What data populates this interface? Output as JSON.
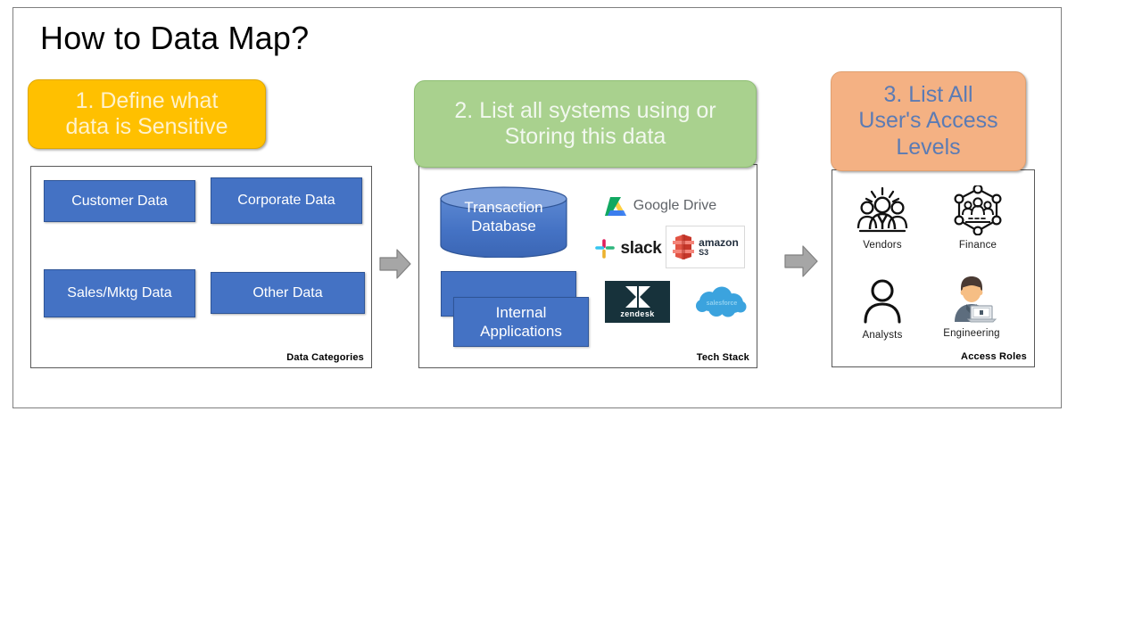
{
  "slide": {
    "title": "How to Data Map?"
  },
  "steps": [
    {
      "header": "1. Define what data is Sensitive",
      "header_lines": [
        "1. Define what",
        "data is Sensitive"
      ],
      "header_color": "#FFC000",
      "header_text_color": "#FFF2CC",
      "caption": "Data Categories",
      "items": [
        {
          "label": "Customer Data"
        },
        {
          "label": "Corporate Data",
          "lines": [
            "Corporate",
            "Data"
          ]
        },
        {
          "label": "Sales/Mktg Data",
          "lines": [
            "Sales/Mktg",
            "Data"
          ]
        },
        {
          "label": "Other Data"
        }
      ]
    },
    {
      "header": "2. List all systems using or Storing this data",
      "header_lines": [
        "2. List all systems using or",
        "Storing this data"
      ],
      "header_color": "#A9D18E",
      "header_text_color": "#F2F8EF",
      "caption": "Tech Stack",
      "shapes": [
        {
          "name": "database-cylinder",
          "label": "Transaction Database",
          "lines": [
            "Transaction",
            "Database"
          ]
        },
        {
          "name": "applications-rectangle",
          "label": "Internal Applications",
          "lines": [
            "Internal",
            "Applications"
          ]
        }
      ],
      "logos": [
        {
          "name": "google-drive-logo",
          "label": "Google Drive",
          "word1": "Google",
          "word2": "Drive"
        },
        {
          "name": "slack-logo",
          "label": "slack"
        },
        {
          "name": "amazon-s3-logo",
          "label": "amazon S3",
          "line1": "amazon",
          "line2": "S3"
        },
        {
          "name": "zendesk-logo",
          "label": "zendesk"
        },
        {
          "name": "salesforce-logo",
          "label": "salesforce"
        }
      ]
    },
    {
      "header": "3. List All User's Access Levels",
      "header_lines": [
        "3. List All",
        "User's Access",
        "Levels"
      ],
      "header_color": "#F4B183",
      "header_text_color": "#5B7BB4",
      "caption": "Access Roles",
      "roles": [
        {
          "label": "Vendors",
          "icon": "group-of-people-icon"
        },
        {
          "label": "Finance",
          "icon": "network-team-icon"
        },
        {
          "label": "Analysts",
          "icon": "single-person-icon"
        },
        {
          "label": "Engineering",
          "icon": "person-with-laptop-icon"
        }
      ]
    }
  ],
  "arrows": [
    {
      "name": "arrow-step1-to-step2",
      "direction": "right"
    },
    {
      "name": "arrow-step2-to-step3",
      "direction": "right"
    }
  ],
  "colors": {
    "frame_border": "#7f7f7f",
    "panel_border": "#595959",
    "box_blue": "#4472C4",
    "box_blue_border": "#2F5597",
    "arrow_fill": "#A6A6A6",
    "arrow_border": "#7F7F7F"
  }
}
